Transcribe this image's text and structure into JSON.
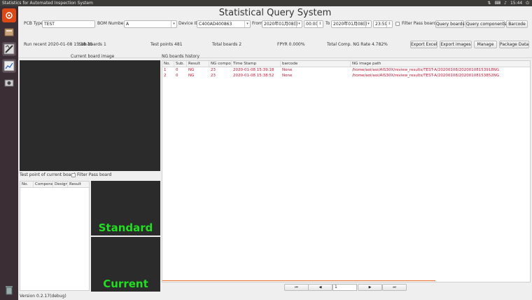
{
  "topbar": {
    "app_title": "Statistics for Automated Inspection System",
    "time": "15:44"
  },
  "launcher": {
    "items": [
      "home-icon",
      "files-icon",
      "tools-icon",
      "chart-app-icon",
      "camera-icon",
      "trash-icon"
    ]
  },
  "page": {
    "title": "Statistical Query System"
  },
  "query": {
    "pcb_type_label": "PCB Type",
    "pcb_type_value": "TEST",
    "bom_label": "BOM Number",
    "bom_value": "A",
    "device_label": "Device ID",
    "device_value": "C400AD400863",
    "from_label": "From",
    "from_date": "2020年01月08日",
    "from_time": "00:00",
    "to_label": "To",
    "to_date": "2020年01月08日",
    "to_time": "23:59",
    "filter_pass_label": "Filter Pass board",
    "query_boards": "Query boards",
    "query_components": "Query components",
    "barcode": "Barcode"
  },
  "stats": {
    "run_recent": "Run recent 2020-01-08 15:38:35",
    "sub_boards": "Sub-boards 1",
    "test_points": "Test points 481",
    "total_boards": "Total boards 2",
    "fpyr": "FPYR 0.000%",
    "ng_rate": "Total Comp. NG Rate   4.782%"
  },
  "actions": {
    "export_excel": "Export Excel",
    "export_images": "Export images",
    "manage": "Manage",
    "package_data": "Package Data"
  },
  "left": {
    "current_board_image": "Current board image",
    "test_point_title": "Test point of current board",
    "filter_pass_label": "Filter Pass board",
    "tp_columns": [
      "No.",
      "Compone",
      "Design",
      "Result"
    ],
    "standard_label": "Standard",
    "current_label": "Current"
  },
  "ng": {
    "title": "NG boards history",
    "columns": [
      "No.",
      "Sub.",
      "Result",
      "NG compor",
      "Time Stamp",
      "barcode",
      "NG image path"
    ],
    "rows": [
      {
        "no": "1",
        "sub": "0",
        "result": "NG",
        "ng": "23",
        "ts": "2020-01-08 15:39:18",
        "barcode": "None",
        "path": "/home/aoi/aoi/AIS30X/review_results/TEST-A/20200108/20200108153918NG"
      },
      {
        "no": "2",
        "sub": "0",
        "result": "NG",
        "ng": "23",
        "ts": "2020-01-08 15:38:52",
        "barcode": "None",
        "path": "/home/aoi/aoi/AIS30X/review_results/TEST-A/20200108/20200108153852NG"
      }
    ]
  },
  "pager": {
    "first": "⏮",
    "prev": "◀",
    "page": "1",
    "next": "▶",
    "last": "⏭"
  },
  "version": "Version 0.2.17(debug)"
}
